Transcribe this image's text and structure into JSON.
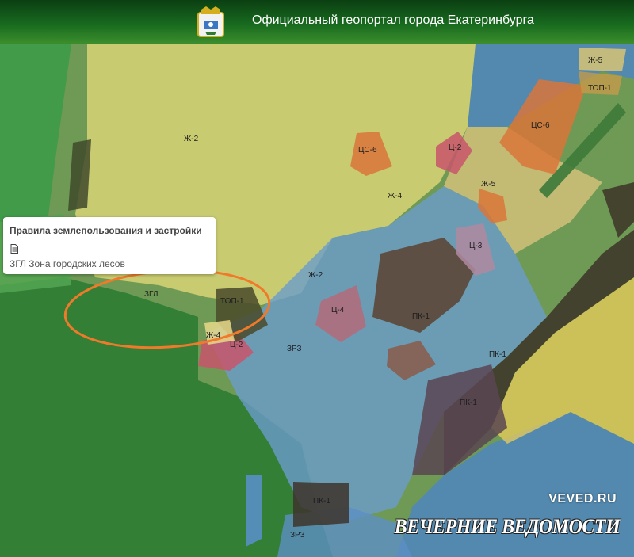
{
  "header": {
    "title": "Официальный геопортал города Екатеринбурга"
  },
  "popup": {
    "title": "Правила землепользования и застройки",
    "zone_text": "ЗГЛ Зона городских лесов"
  },
  "zones": {
    "zh2_a": "Ж-2",
    "zh2_b": "Ж-2",
    "cs6_a": "ЦС-6",
    "cs6_b": "ЦС-6",
    "c2_a": "Ц-2",
    "c2_b": "Ц-2",
    "zh4_a": "Ж-4",
    "zh4_b": "Ж-4",
    "zh5_a": "Ж-5",
    "zh5_b": "Ж-5",
    "top1_a": "ТОП-1",
    "top1_b": "ТОП-1",
    "c3": "Ц-3",
    "c4": "Ц-4",
    "pk1_a": "ПК-1",
    "pk1_b": "ПК-1",
    "pk1_c": "ПК-1",
    "pk1_d": "ПК-1",
    "zrz_a": "ЗРЗ",
    "zrz_b": "ЗРЗ",
    "zgl": "ЗГЛ"
  },
  "colors": {
    "header": "#186a1f",
    "forest_zone": "#2f8a3b",
    "residential_zone": "#e3d97a",
    "recreation_zone": "#5d8fc4",
    "commercial_zone": "#d9763a",
    "center_zone": "#c8556b",
    "industrial_zone": "#5a4230",
    "highlight_ellipse": "#f07a2a"
  },
  "watermark": {
    "url": "VEVED.RU",
    "name": "ВЕЧЕРНИЕ ВЕДОМОСТИ"
  }
}
